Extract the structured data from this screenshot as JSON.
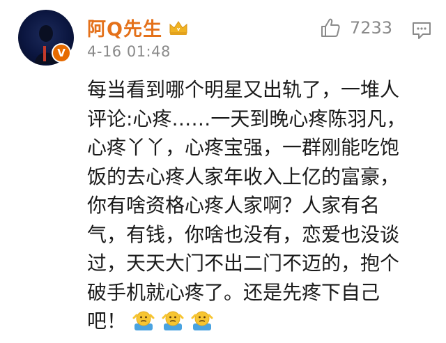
{
  "comment": {
    "username": "阿Q先生",
    "timestamp": "4-16 01:48",
    "like_count": "7233",
    "verify_badge": "V",
    "avatar_icon": "avatar-person-icon",
    "vip_icon": "vip-crown-icon",
    "like_icon": "thumbs-up-icon",
    "reply_icon": "comment-reply-icon",
    "body_lines": [
      "每当看到哪个明星又出轨了，一堆人",
      "评论:心疼……一天到晚心疼陈羽凡，",
      "心疼丫丫，心疼宝强，一群刚能吃饱",
      "饭的去心疼人家年收入上亿的富豪，",
      "你有啥资格心疼人家啊？人家有名",
      "气，有钱，你啥也没有，恋爱也没谈",
      "过，天天大门不出二门不迈的，抱个",
      "破手机就心疼了。还是先疼下自己",
      "吧！"
    ],
    "emojis": [
      "shrug-emoji",
      "shrug-emoji",
      "shrug-emoji"
    ],
    "colors": {
      "username": "#e4711a",
      "meta_gray": "#8a8a8a",
      "verify_orange": "#e66a00",
      "vip_gold": "#f0b323"
    }
  }
}
